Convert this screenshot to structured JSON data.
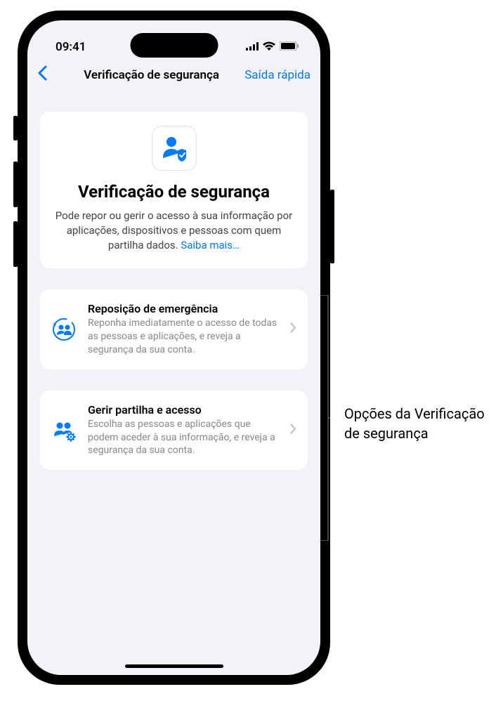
{
  "status": {
    "time": "09:41"
  },
  "nav": {
    "title": "Verificação de segurança",
    "quick_exit": "Saída rápida"
  },
  "header": {
    "title": "Verificação de segurança",
    "description": "Pode repor ou gerir o acesso à sua informação por aplicações, dispositivos e pessoas com quem partilha dados. ",
    "learn_more": "Saiba mais…"
  },
  "options": [
    {
      "title": "Reposição de emergência",
      "description": "Reponha imediatamente o acesso de todas as pessoas e aplicações, e reveja a segurança da sua conta."
    },
    {
      "title": "Gerir partilha e acesso",
      "description": "Escolha as pessoas e aplicações que podem aceder à sua informação, e reveja a segurança da sua conta."
    }
  ],
  "callout": {
    "text": "Opções da Verificação de segurança"
  }
}
